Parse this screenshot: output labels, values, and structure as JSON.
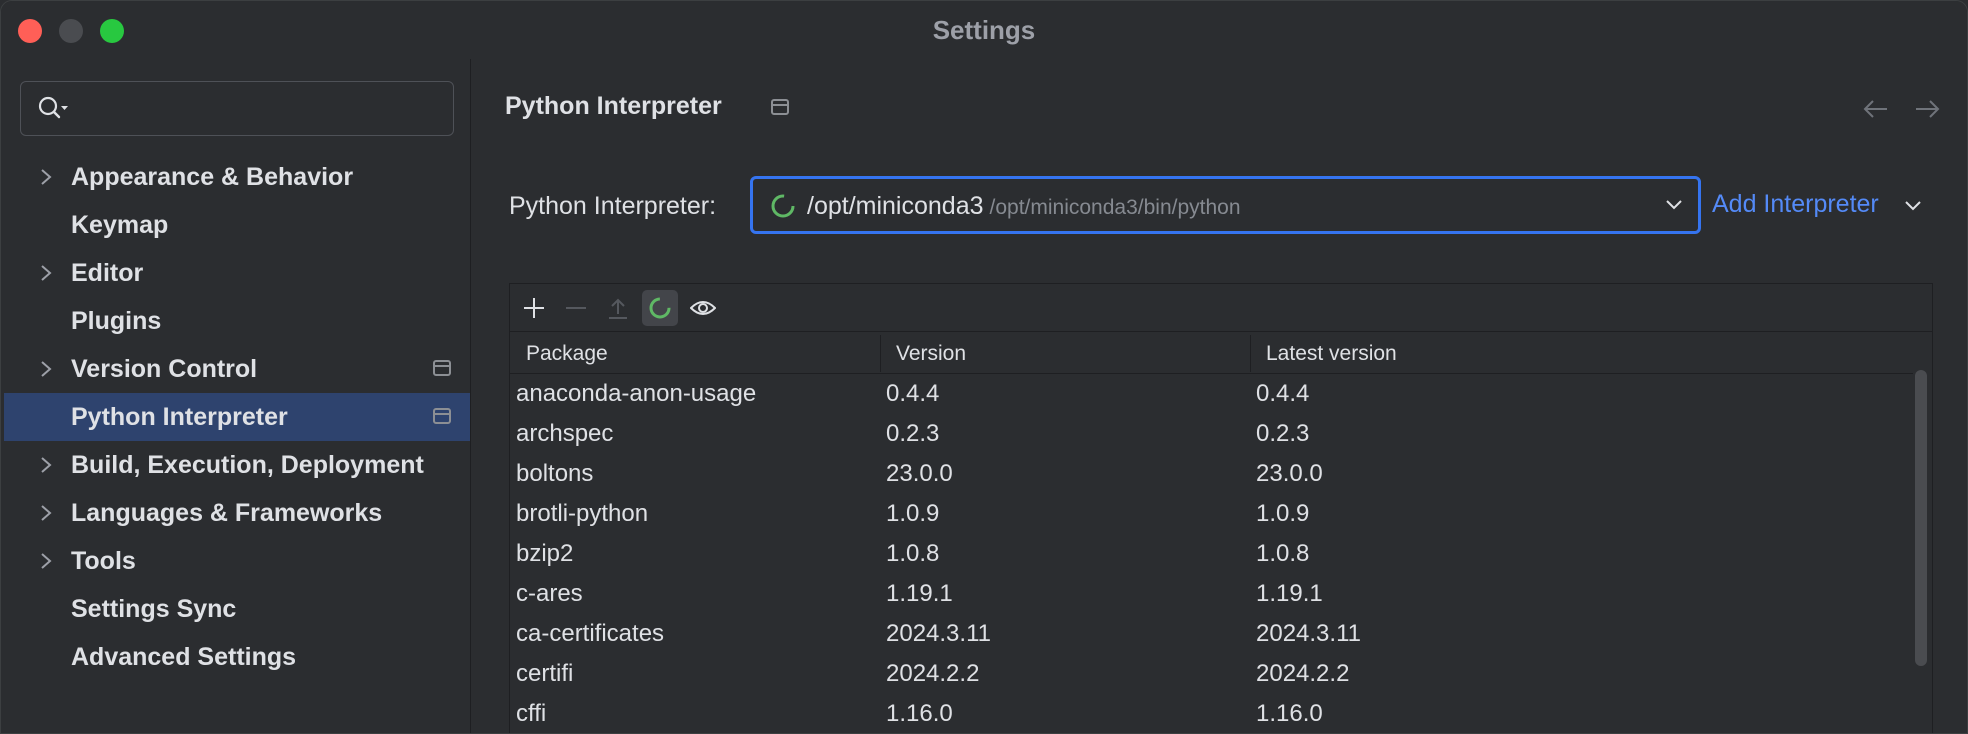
{
  "window": {
    "title": "Settings"
  },
  "sidebar": {
    "search_placeholder": "",
    "items": [
      {
        "label": "Appearance & Behavior",
        "expandable": true,
        "badge": false,
        "selected": false
      },
      {
        "label": "Keymap",
        "expandable": false,
        "badge": false,
        "selected": false
      },
      {
        "label": "Editor",
        "expandable": true,
        "badge": false,
        "selected": false
      },
      {
        "label": "Plugins",
        "expandable": false,
        "badge": false,
        "selected": false
      },
      {
        "label": "Version Control",
        "expandable": true,
        "badge": true,
        "selected": false
      },
      {
        "label": "Python Interpreter",
        "expandable": false,
        "badge": true,
        "selected": true
      },
      {
        "label": "Build, Execution, Deployment",
        "expandable": true,
        "badge": false,
        "selected": false
      },
      {
        "label": "Languages & Frameworks",
        "expandable": true,
        "badge": false,
        "selected": false
      },
      {
        "label": "Tools",
        "expandable": true,
        "badge": false,
        "selected": false
      },
      {
        "label": "Settings Sync",
        "expandable": false,
        "badge": false,
        "selected": false
      },
      {
        "label": "Advanced Settings",
        "expandable": false,
        "badge": false,
        "selected": false
      }
    ]
  },
  "main": {
    "title": "Python Interpreter",
    "interpreter_label": "Python Interpreter:",
    "interpreter_name": "/opt/miniconda3",
    "interpreter_path": "/opt/miniconda3/bin/python",
    "add_interpreter": "Add Interpreter",
    "columns": [
      "Package",
      "Version",
      "Latest version"
    ],
    "packages": [
      {
        "name": "anaconda-anon-usage",
        "version": "0.4.4",
        "latest": "0.4.4"
      },
      {
        "name": "archspec",
        "version": "0.2.3",
        "latest": "0.2.3"
      },
      {
        "name": "boltons",
        "version": "23.0.0",
        "latest": "23.0.0"
      },
      {
        "name": "brotli-python",
        "version": "1.0.9",
        "latest": "1.0.9"
      },
      {
        "name": "bzip2",
        "version": "1.0.8",
        "latest": "1.0.8"
      },
      {
        "name": "c-ares",
        "version": "1.19.1",
        "latest": "1.19.1"
      },
      {
        "name": "ca-certificates",
        "version": "2024.3.11",
        "latest": "2024.3.11"
      },
      {
        "name": "certifi",
        "version": "2024.2.2",
        "latest": "2024.2.2"
      },
      {
        "name": "cffi",
        "version": "1.16.0",
        "latest": "1.16.0"
      }
    ]
  },
  "colors": {
    "background": "#2b2d30",
    "selection": "#2e436e",
    "accent": "#3574f0",
    "link": "#548af7",
    "spinner": "#5fb865"
  }
}
